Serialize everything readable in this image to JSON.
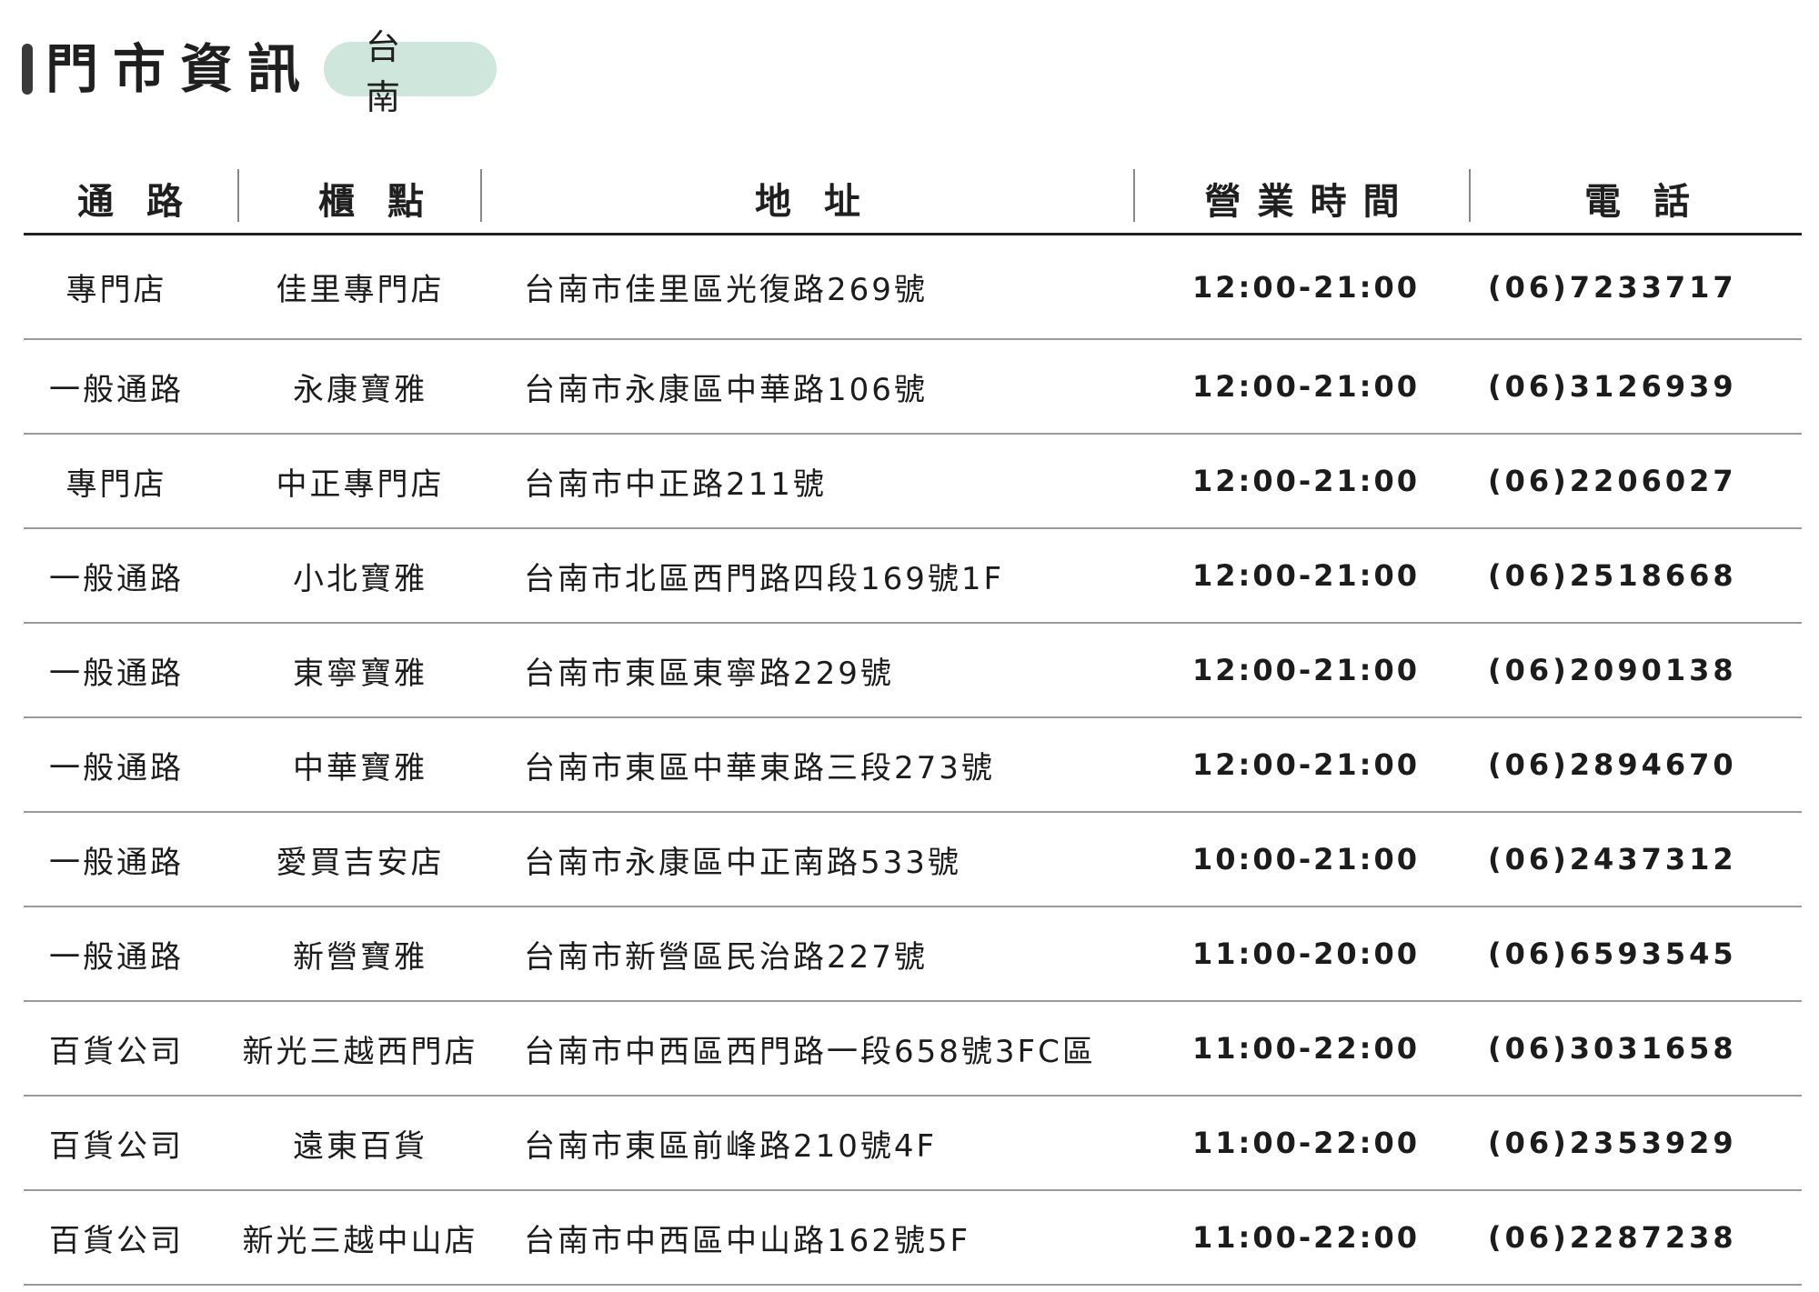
{
  "header": {
    "title": "門市資訊",
    "city": "台南"
  },
  "table": {
    "columns": [
      "通路",
      "櫃點",
      "地址",
      "營業時間",
      "電話"
    ],
    "rows": [
      {
        "channel": "專門店",
        "store": "佳里專門店",
        "address": "台南市佳里區光復路269號",
        "hours": "12:00-21:00",
        "phone": "(06)7233717"
      },
      {
        "channel": "一般通路",
        "store": "永康寶雅",
        "address": "台南市永康區中華路106號",
        "hours": "12:00-21:00",
        "phone": "(06)3126939"
      },
      {
        "channel": "專門店",
        "store": "中正專門店",
        "address": "台南市中正路211號",
        "hours": "12:00-21:00",
        "phone": "(06)2206027"
      },
      {
        "channel": "一般通路",
        "store": "小北寶雅",
        "address": "台南市北區西門路四段169號1F",
        "hours": "12:00-21:00",
        "phone": "(06)2518668"
      },
      {
        "channel": "一般通路",
        "store": "東寧寶雅",
        "address": "台南市東區東寧路229號",
        "hours": "12:00-21:00",
        "phone": "(06)2090138"
      },
      {
        "channel": "一般通路",
        "store": "中華寶雅",
        "address": "台南市東區中華東路三段273號",
        "hours": "12:00-21:00",
        "phone": "(06)2894670"
      },
      {
        "channel": "一般通路",
        "store": "愛買吉安店",
        "address": "台南市永康區中正南路533號",
        "hours": "10:00-21:00",
        "phone": "(06)2437312"
      },
      {
        "channel": "一般通路",
        "store": "新營寶雅",
        "address": "台南市新營區民治路227號",
        "hours": "11:00-20:00",
        "phone": "(06)6593545"
      },
      {
        "channel": "百貨公司",
        "store": "新光三越西門店",
        "address": "台南市中西區西門路一段658號3FC區",
        "hours": "11:00-22:00",
        "phone": "(06)3031658"
      },
      {
        "channel": "百貨公司",
        "store": "遠東百貨",
        "address": "台南市東區前峰路210號4F",
        "hours": "11:00-22:00",
        "phone": "(06)2353929"
      },
      {
        "channel": "百貨公司",
        "store": "新光三越中山店",
        "address": "台南市中西區中山路162號5F",
        "hours": "11:00-22:00",
        "phone": "(06)2287238"
      }
    ]
  }
}
